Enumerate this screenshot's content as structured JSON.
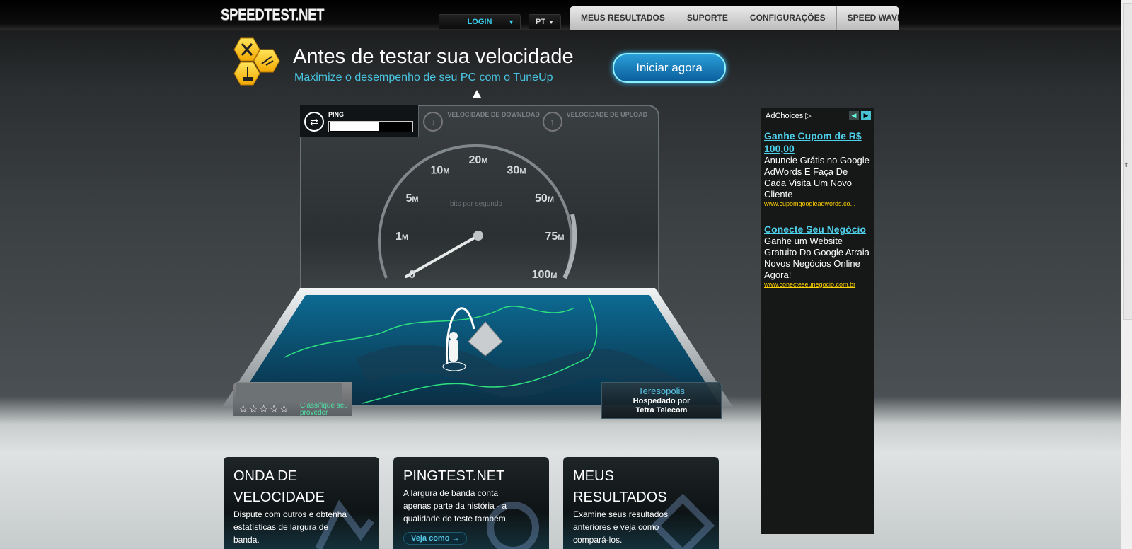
{
  "header": {
    "logo": "SPEEDTEST.NET",
    "login_label": "LOGIN",
    "language": "PT",
    "nav": [
      "MEUS RESULTADOS",
      "SUPORTE",
      "CONFIGURAÇÕES",
      "SPEED WAVE"
    ]
  },
  "promo": {
    "title": "Antes de testar sua velocidade",
    "subtitle": "Maximize o desempenho de seu PC com o TuneUp",
    "button": "Iniciar agora"
  },
  "tester": {
    "metrics": [
      {
        "label": "PING",
        "icon": "exchange-arrows-icon",
        "state": "active"
      },
      {
        "label": "VELOCIDADE DE DOWNLOAD",
        "icon": "download-arrow-icon",
        "state": "inactive"
      },
      {
        "label": "VELOCIDADE DE UPLOAD",
        "icon": "upload-arrow-icon",
        "state": "inactive"
      }
    ],
    "ping_progress": 0.6,
    "gauge": {
      "unit_label": "bits por segundo",
      "ticks": [
        {
          "value": "0",
          "suffix": ""
        },
        {
          "value": "1",
          "suffix": "M"
        },
        {
          "value": "5",
          "suffix": "M"
        },
        {
          "value": "10",
          "suffix": "M"
        },
        {
          "value": "20",
          "suffix": "M"
        },
        {
          "value": "30",
          "suffix": "M"
        },
        {
          "value": "50",
          "suffix": "M"
        },
        {
          "value": "75",
          "suffix": "M"
        },
        {
          "value": "100",
          "suffix": "M"
        }
      ],
      "needle_value": "1M"
    },
    "provider": {
      "rating_stars": 5,
      "rate_label": "Classifique seu provedor"
    },
    "server": {
      "city": "Teresopolis",
      "hosted_by": "Hospedado por",
      "host": "Tetra Telecom"
    }
  },
  "ad": {
    "adchoices": "AdChoices",
    "items": [
      {
        "headline": "Ganhe Cupom de R$ 100,00",
        "text": "Anuncie Grátis no Google AdWords E Faça De Cada Visita Um Novo Cliente",
        "url": "www.cupomgoogleadwords.co..."
      },
      {
        "headline": "Conecte Seu Negócio",
        "text": "Ganhe um Website Gratuito Do Google Atraia Novos Negócios Online Agora!",
        "url": "www.conecteseunegocio.com.br"
      }
    ]
  },
  "cards": [
    {
      "title": "ONDA DE VELOCIDADE",
      "text": "Dispute com outros e obtenha estatísticas de largura de banda.",
      "link": ""
    },
    {
      "title": "PINGTEST.NET",
      "text": "A largura de banda conta apenas parte da história - a qualidade do teste também.",
      "link": "Veja como →"
    },
    {
      "title": "MEUS RESULTADOS",
      "text": "Examine seus resultados anteriores e veja como compará-los.",
      "link": ""
    }
  ],
  "colors": {
    "accent": "#49c6e3",
    "map_line": "#2fe07f",
    "ad_link": "#4fd0ea",
    "ad_url": "#ffd200"
  }
}
